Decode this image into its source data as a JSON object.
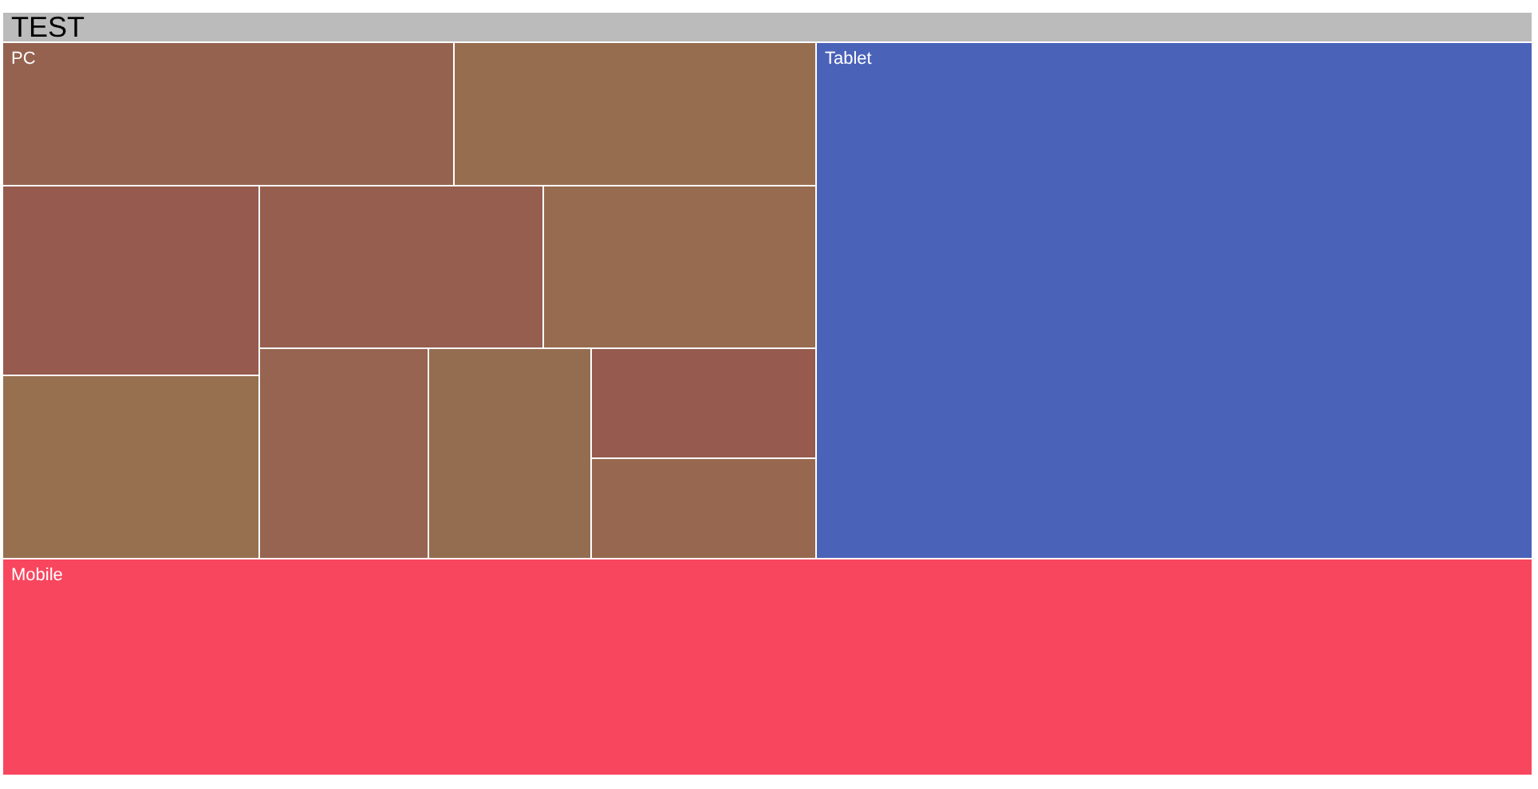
{
  "title": "TEST",
  "groups": [
    {
      "label": "PC",
      "tiles": [
        {
          "color": "#966250"
        },
        {
          "color": "#976d50"
        },
        {
          "color": "#965a4e"
        },
        {
          "color": "#97704f"
        },
        {
          "color": "#965e4e"
        },
        {
          "color": "#976b4f"
        },
        {
          "color": "#966450"
        },
        {
          "color": "#946c4f"
        },
        {
          "color": "#965a4e"
        },
        {
          "color": "#97684f"
        }
      ]
    },
    {
      "label": "Tablet",
      "color": "#4b62b9"
    },
    {
      "label": "Mobile",
      "color": "#f9465f"
    }
  ]
}
